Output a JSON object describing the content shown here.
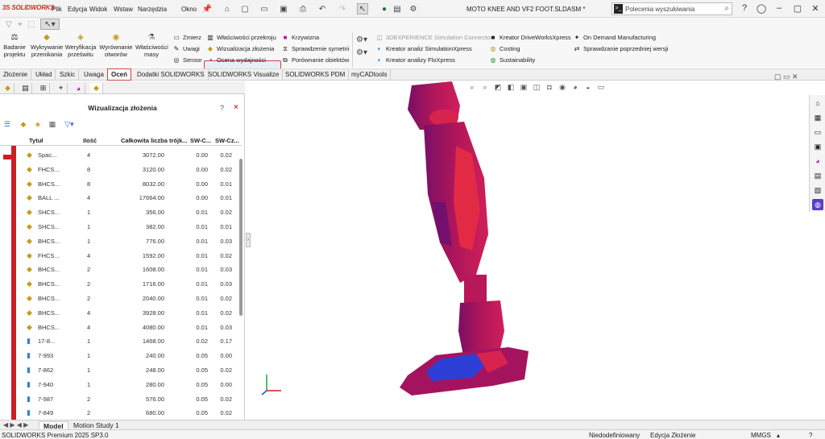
{
  "titlebar": {
    "logo_text": "SOLIDWORKS",
    "menu": [
      "Plik",
      "Edycja",
      "Widok",
      "Wstaw",
      "Narzędzia",
      "Okno"
    ],
    "document_title": "MOTO KNEE AND VF2 FOOT.SLDASM *",
    "search_placeholder": "Polecenia wyszukiwania",
    "icons": [
      "home-icon",
      "new-icon",
      "open-icon",
      "save-icon",
      "print-icon",
      "undo-icon",
      "redo-icon",
      "select-icon",
      "rebuild-icon",
      "options-icon"
    ]
  },
  "ribbon": {
    "big_buttons": [
      {
        "label1": "Badanie",
        "label2": "projektu"
      },
      {
        "label1": "Wykrywanie",
        "label2": "przenikania"
      },
      {
        "label1": "Weryfikacja",
        "label2": "prześwitu"
      },
      {
        "label1": "Wyrównanie",
        "label2": "otworów"
      },
      {
        "label1": "Właściwości",
        "label2": "masy"
      }
    ],
    "col1": [
      "Zmierz",
      "Uwagi",
      "Sensor"
    ],
    "col2": [
      "Właściwości przekroju",
      "Wizualizacja złożenia",
      "Ocena wydajności"
    ],
    "col3": [
      "Krzywizna",
      "Sprawdzenie symetrii",
      "Porównanie obiektów"
    ],
    "col4": [
      "3DEXPERIENCE Simulation Connector",
      "Kreator analiz SimulationXpress",
      "Kreator analizy FloXpress"
    ],
    "col5": [
      "Kreator DriveWorksXpress",
      "Costing",
      "Sustainability"
    ],
    "col6": [
      "On Demand Manufacturing",
      "Sprawdzanie poprzedniej wersji"
    ]
  },
  "tabs": [
    "Złożenie",
    "Układ",
    "Szkic",
    "Uwaga",
    "Oceń",
    "Dodatki SOLIDWORKS",
    "SOLIDWORKS Visualize",
    "SOLIDWORKS PDM",
    "myCADtools"
  ],
  "active_tab": "Oceń",
  "panel": {
    "title": "Wizualizacja złożenia",
    "help": "?",
    "close": "×",
    "columns": [
      "Tytuł",
      "Ilość",
      "Całkowita liczba trójk...",
      "SW-C...",
      "SW-Cz..."
    ],
    "rows": [
      {
        "name": "Spac...",
        "qty": "4",
        "tri": "3072.00",
        "c1": "0.00",
        "c2": "0.02"
      },
      {
        "name": "FHCS...",
        "qty": "8",
        "tri": "3120.00",
        "c1": "0.00",
        "c2": "0.02"
      },
      {
        "name": "BHCS...",
        "qty": "8",
        "tri": "8032.00",
        "c1": "0.00",
        "c2": "0.01"
      },
      {
        "name": "BALL ...",
        "qty": "4",
        "tri": "17664.00",
        "c1": "0.00",
        "c2": "0.01"
      },
      {
        "name": "SHCS...",
        "qty": "1",
        "tri": "356.00",
        "c1": "0.01",
        "c2": "0.02"
      },
      {
        "name": "SHCS...",
        "qty": "1",
        "tri": "382.00",
        "c1": "0.01",
        "c2": "0.01"
      },
      {
        "name": "BHCS...",
        "qty": "1",
        "tri": "776.00",
        "c1": "0.01",
        "c2": "0.03"
      },
      {
        "name": "FHCS...",
        "qty": "4",
        "tri": "1592.00",
        "c1": "0.01",
        "c2": "0.02"
      },
      {
        "name": "BHCS...",
        "qty": "2",
        "tri": "1608.00",
        "c1": "0.01",
        "c2": "0.03"
      },
      {
        "name": "BHCS...",
        "qty": "2",
        "tri": "1716.00",
        "c1": "0.01",
        "c2": "0.03"
      },
      {
        "name": "BHCS...",
        "qty": "2",
        "tri": "2040.00",
        "c1": "0.01",
        "c2": "0.02"
      },
      {
        "name": "BHCS...",
        "qty": "4",
        "tri": "3928.00",
        "c1": "0.01",
        "c2": "0.02"
      },
      {
        "name": "BHCS...",
        "qty": "4",
        "tri": "4080.00",
        "c1": "0.01",
        "c2": "0.03"
      },
      {
        "name": "17-8...",
        "qty": "1",
        "tri": "1468.00",
        "c1": "0.02",
        "c2": "0.17"
      },
      {
        "name": "7-993",
        "qty": "1",
        "tri": "240.00",
        "c1": "0.05",
        "c2": "0.00"
      },
      {
        "name": "7-862",
        "qty": "1",
        "tri": "248.00",
        "c1": "0.05",
        "c2": "0.02"
      },
      {
        "name": "7-940",
        "qty": "1",
        "tri": "280.00",
        "c1": "0.05",
        "c2": "0.00"
      },
      {
        "name": "7-987",
        "qty": "2",
        "tri": "576.00",
        "c1": "0.05",
        "c2": "0.02"
      },
      {
        "name": "7-849",
        "qty": "2",
        "tri": "680.00",
        "c1": "0.05",
        "c2": "0.02"
      }
    ]
  },
  "bottom_tabs": [
    "Model",
    "Motion Study 1"
  ],
  "status": {
    "left": "SOLIDWORKS Premium 2025 SP3.0",
    "center1": "Niedodefiniowany",
    "center2": "Edycja Złożenie",
    "units": "MMGS"
  },
  "colors": {
    "accent_red": "#cc1f24",
    "highlight": "#d04040",
    "model_magenta": "#b0165a",
    "model_blue": "#2d3fd6"
  }
}
